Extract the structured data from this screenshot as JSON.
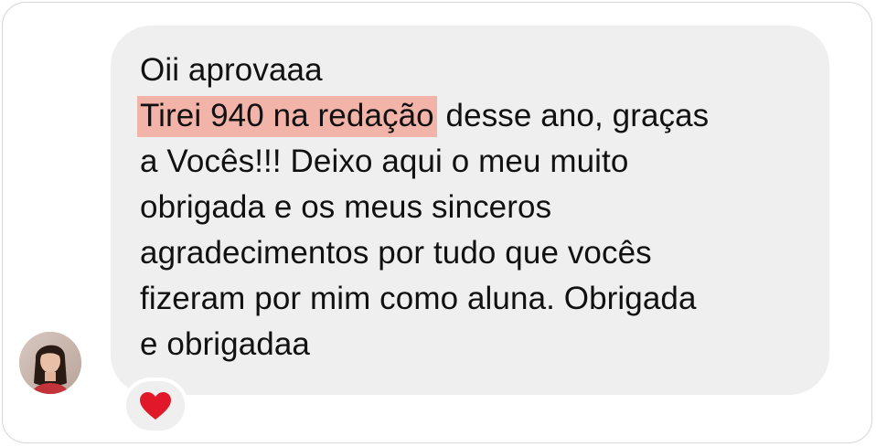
{
  "message": {
    "lines": [
      "Oii aprovaaa",
      "Tirei 940 na redação",
      " desse ano, graças",
      "a Vocês!!! Deixo aqui o meu muito",
      "obrigada e os meus sinceros",
      "agradecimentos por tudo que vocês",
      "fizeram por mim como aluna. Obrigada",
      "e obrigadaa"
    ],
    "highlight_color": "#f2b3a8",
    "bubble_color": "#efefef"
  },
  "reaction": {
    "icon": "red-heart-icon",
    "color": "#e0182a"
  },
  "avatar": {
    "icon": "user-avatar-photo"
  }
}
